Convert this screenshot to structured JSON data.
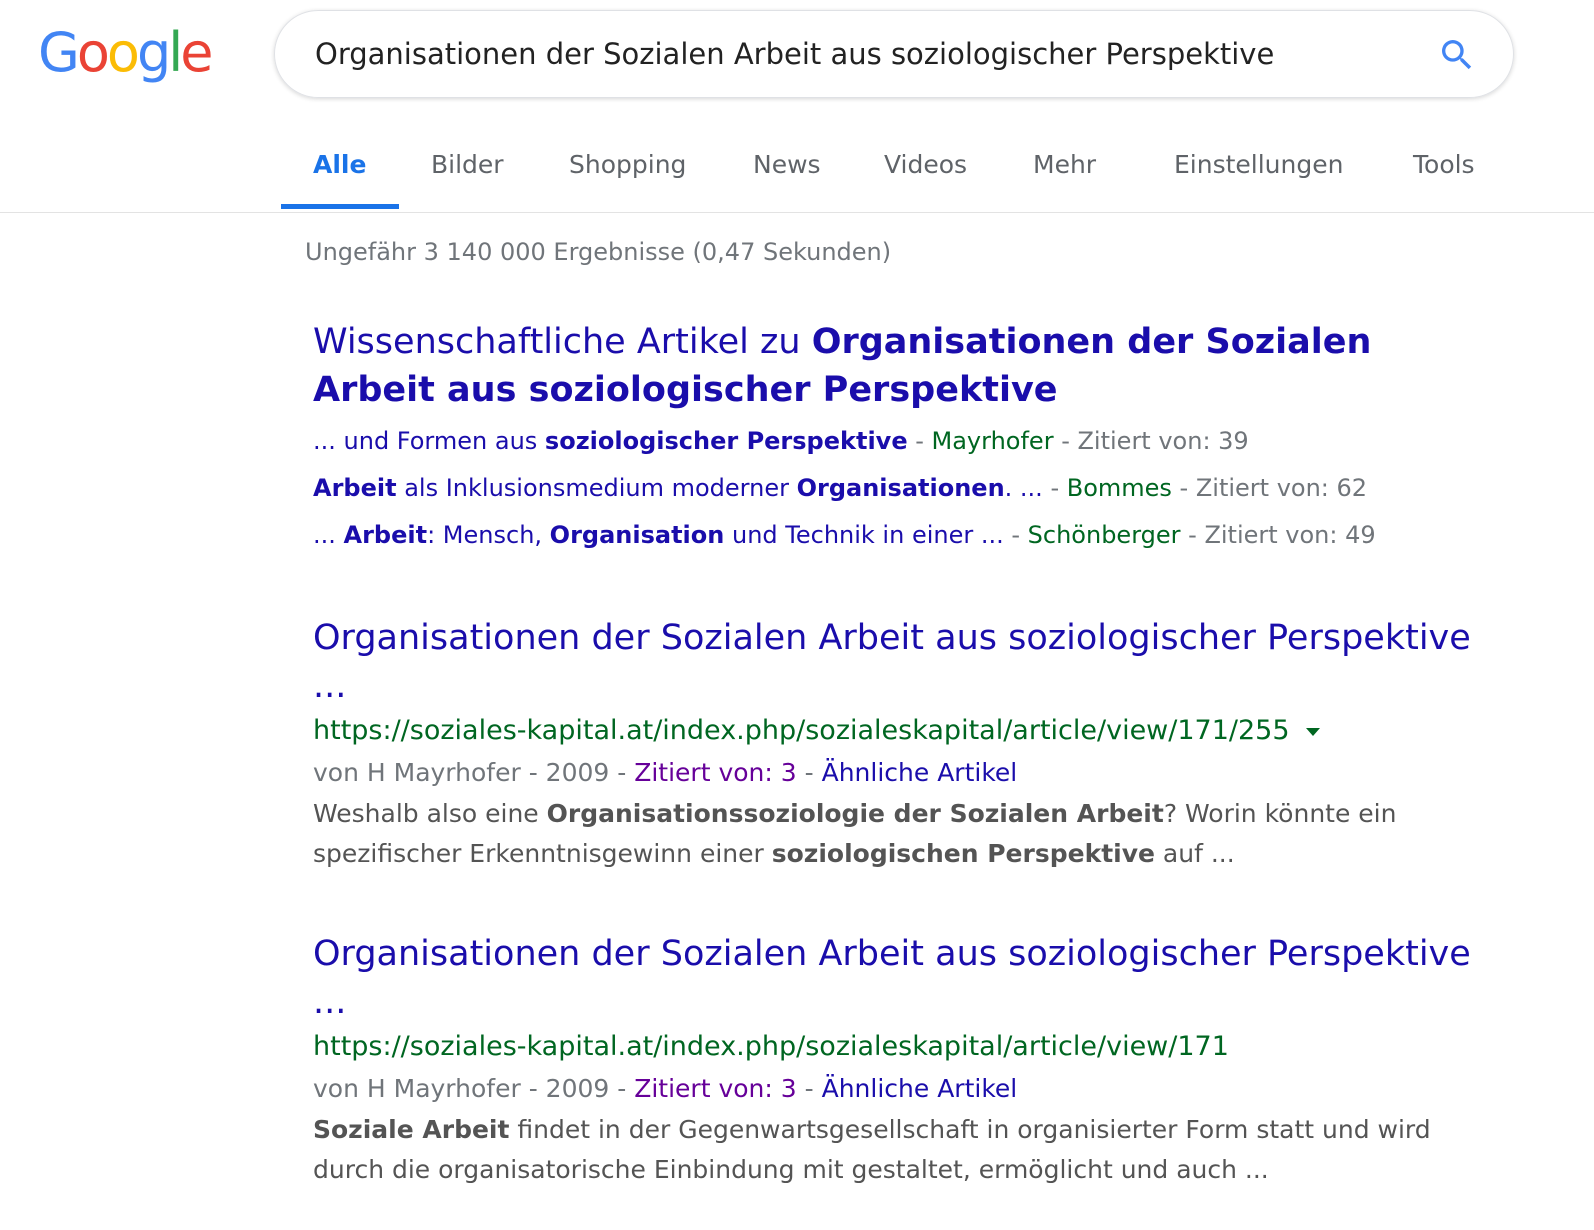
{
  "header": {
    "logo_letters": [
      {
        "ch": "G",
        "color": "#4285f4"
      },
      {
        "ch": "o",
        "color": "#ea4335"
      },
      {
        "ch": "o",
        "color": "#fbbc05"
      },
      {
        "ch": "g",
        "color": "#4285f4"
      },
      {
        "ch": "l",
        "color": "#34a853"
      },
      {
        "ch": "e",
        "color": "#ea4335"
      }
    ],
    "search_query": "Organisationen der Sozialen Arbeit aus soziologischer Perspektive",
    "search_icon": "search-icon",
    "accent_color": "#1a73e8"
  },
  "tabs": {
    "alle": "Alle",
    "bilder": "Bilder",
    "shopping": "Shopping",
    "news": "News",
    "videos": "Videos",
    "mehr": "Mehr",
    "einstellungen": "Einstellungen",
    "tools": "Tools",
    "active": "Alle"
  },
  "result_stats": "Ungefähr 3 140 000 Ergebnisse (0,47 Sekunden)",
  "scholar": {
    "title_plain": "Wissenschaftliche Artikel zu ",
    "title_bold": "Organisationen der Sozialen Arbeit aus soziologischer Perspektive",
    "items": [
      {
        "pre": "... und Formen aus ",
        "b1": "soziologischer Perspektive",
        "mid": "",
        "b2": "",
        "post": "",
        "author": "Mayrhofer",
        "cited": "Zitiert von: 39"
      },
      {
        "pre": "",
        "b1": "Arbeit",
        "mid": " als Inklusionsmedium moderner ",
        "b2": "Organisationen",
        "post": ". ...",
        "author": "Bommes",
        "cited": "Zitiert von: 62"
      },
      {
        "pre": "... ",
        "b1": "Arbeit",
        "mid": ": Mensch, ",
        "b2": "Organisation",
        "post": " und Technik in einer ...",
        "author": "Schönberger",
        "cited": "Zitiert von: 49"
      }
    ],
    "separator": " - "
  },
  "results": [
    {
      "title": "Organisationen der Sozialen Arbeit aus soziologischer Perspektive ...",
      "url": "https://soziales-kapital.at/index.php/sozialeskapital/article/view/171/255",
      "has_caret": true,
      "meta_prefix": "von H Mayrhofer - 2009 - ",
      "cited": "Zitiert von: 3",
      "meta_sep": " - ",
      "similar": "Ähnliche Artikel",
      "snippet": {
        "s1": "Weshalb also eine ",
        "b1": "Organisationssoziologie der Sozialen Arbeit",
        "s2": "? Worin könnte ein spezifischer Erkenntnisgewinn einer ",
        "b2": "soziologischen Perspektive",
        "s3": " auf ..."
      }
    },
    {
      "title": "Organisationen der Sozialen Arbeit aus soziologischer Perspektive ...",
      "url": "https://soziales-kapital.at/index.php/sozialeskapital/article/view/171",
      "has_caret": false,
      "meta_prefix": "von H Mayrhofer - 2009 - ",
      "cited": "Zitiert von: 3",
      "meta_sep": " - ",
      "similar": "Ähnliche Artikel",
      "snippet": {
        "s1": "",
        "b1": "Soziale Arbeit",
        "s2": " findet in der Gegenwartsgesellschaft in organisierter Form statt und wird durch die organisatorische Einbindung mit gestaltet, ermöglicht und auch ...",
        "b2": "",
        "s3": ""
      }
    }
  ]
}
